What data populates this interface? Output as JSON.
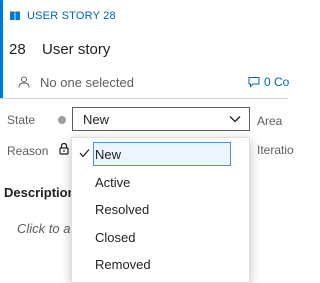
{
  "header": {
    "type_label": "USER STORY 28",
    "id": "28",
    "title": "User story",
    "assigned_to": "No one selected",
    "comments_label": "0 Co"
  },
  "fields": {
    "state_label": "State",
    "state_value": "New",
    "area_label": "Area",
    "reason_label": "Reason",
    "iteration_label": "Iteratio"
  },
  "description": {
    "title": "Description",
    "placeholder": "Click to ad"
  },
  "dropdown": {
    "options": [
      "New",
      "Active",
      "Resolved",
      "Closed",
      "Removed"
    ],
    "selected": "New"
  },
  "colors": {
    "accent": "#0078d4",
    "link": "#0064b4"
  }
}
